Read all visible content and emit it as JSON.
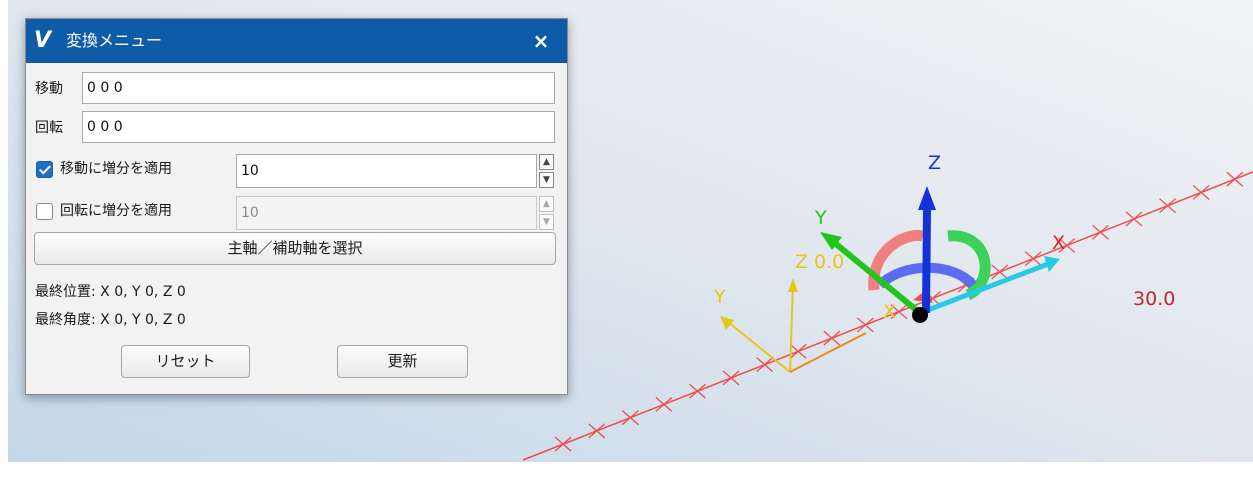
{
  "dialog": {
    "logo": "V",
    "title": "変換メニュー",
    "close_glyph": "×",
    "move_label": "移動",
    "move_value": "0 0 0",
    "rotate_label": "回転",
    "rotate_value": "0 0 0",
    "move_increment": {
      "label": "移動に増分を適用",
      "checked": true,
      "value": "10"
    },
    "rotate_increment": {
      "label": "回転に増分を適用",
      "checked": false,
      "value": "10"
    },
    "axis_button": "主軸／補助軸を選択",
    "final_position": "最終位置: X 0, Y 0, Z 0",
    "final_angle": "最終角度: X 0, Y 0, Z 0",
    "reset_button": "リセット",
    "update_button": "更新",
    "spin_up_glyph": "▲",
    "spin_down_glyph": "▼"
  },
  "viewport": {
    "dimension_value": "30.0",
    "gizmo_labels": {
      "x": "X",
      "y": "Y",
      "z": "Z"
    },
    "secondary_labels": {
      "y": "Y",
      "z": "Z 0.0",
      "x": "X"
    },
    "colors": {
      "x_axis": "#e0242b",
      "y_axis": "#22c61b",
      "z_axis": "#1432d6",
      "secondary": "#e6c619",
      "guide_line": "#ef4b4b",
      "cyan_arrow": "#28c9e6"
    }
  }
}
